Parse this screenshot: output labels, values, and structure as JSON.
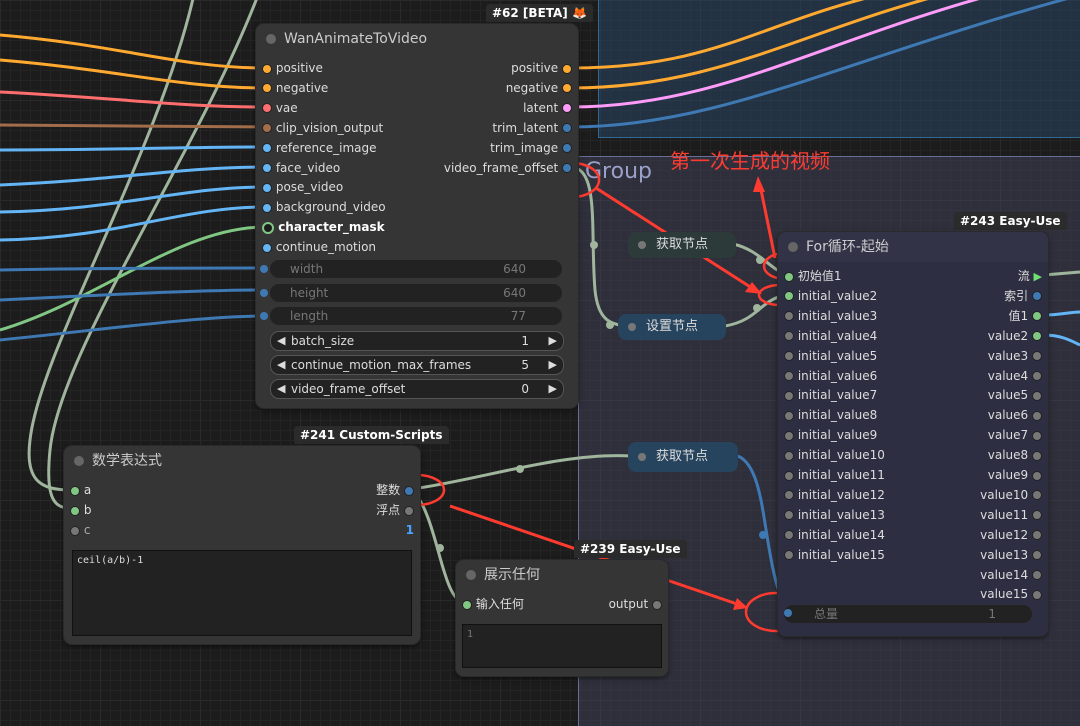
{
  "groups": {
    "main_title": "Group"
  },
  "annotation": {
    "text": "第一次生成的视频"
  },
  "wan": {
    "badge": "#62 [BETA] 🦊",
    "title": "WanAnimateToVideo",
    "inputs": [
      "positive",
      "negative",
      "vae",
      "clip_vision_output",
      "reference_image",
      "face_video",
      "pose_video",
      "background_video",
      "character_mask",
      "continue_motion"
    ],
    "outputs": [
      "positive",
      "negative",
      "latent",
      "trim_latent",
      "trim_image",
      "video_frame_offset"
    ],
    "widgets": [
      {
        "label": "width",
        "value": "640"
      },
      {
        "label": "height",
        "value": "640"
      },
      {
        "label": "length",
        "value": "77"
      },
      {
        "label": "batch_size",
        "value": "1"
      },
      {
        "label": "continue_motion_max_frames",
        "value": "5"
      },
      {
        "label": "video_frame_offset",
        "value": "0"
      }
    ]
  },
  "math": {
    "badge": "#241 Custom-Scripts",
    "title": "数学表达式",
    "inputs": [
      "a",
      "b",
      "c"
    ],
    "outputs": [
      "整数",
      "浮点",
      "1"
    ],
    "expression": "ceil(a/b)-1"
  },
  "show": {
    "badge": "#239 Easy-Use",
    "title": "展示任何",
    "input": "输入任何",
    "output": "output",
    "content": "1"
  },
  "get1": {
    "title": "获取节点"
  },
  "set1": {
    "title": "设置节点"
  },
  "get2": {
    "title": "获取节点"
  },
  "loop": {
    "badge": "#243 Easy-Use",
    "title": "For循环-起始",
    "inputs": [
      "初始值1",
      "initial_value2",
      "initial_value3",
      "initial_value4",
      "initial_value5",
      "initial_value6",
      "initial_value7",
      "initial_value8",
      "initial_value9",
      "initial_value10",
      "initial_value11",
      "initial_value12",
      "initial_value13",
      "initial_value14",
      "initial_value15"
    ],
    "outputs": [
      "流",
      "索引",
      "值1",
      "value2",
      "value3",
      "value4",
      "value5",
      "value6",
      "value7",
      "value8",
      "value9",
      "value10",
      "value11",
      "value12",
      "value13",
      "value14",
      "value15"
    ],
    "total_label": "总量",
    "total_value": "1"
  },
  "colors": {
    "accent_red": "#ff3b30",
    "clip": "#ffd500",
    "conditioning": "#ffa931",
    "vae": "#ff6e6e",
    "latent": "#ff9cf9",
    "image": "#64b5f6",
    "mask": "#81c784"
  }
}
